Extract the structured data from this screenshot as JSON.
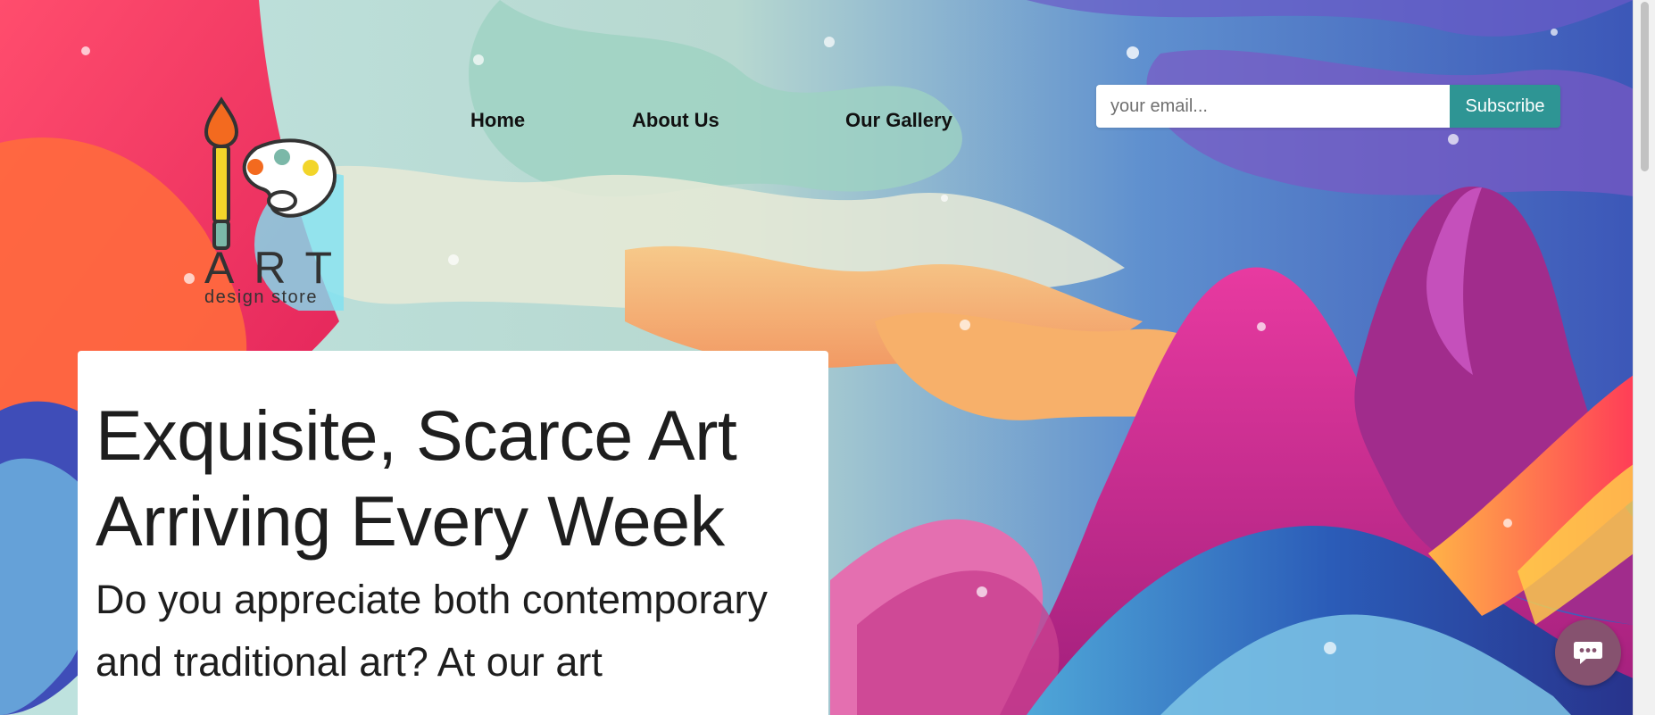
{
  "logo": {
    "brand": "ART",
    "tagline": "design store"
  },
  "nav": {
    "items": [
      {
        "label": "Home"
      },
      {
        "label": "About Us"
      },
      {
        "label": "Our Gallery"
      }
    ]
  },
  "subscribe": {
    "placeholder": "your email...",
    "button_label": "Subscribe"
  },
  "hero": {
    "heading": "Exquisite, Scarce Art Arriving Every Week",
    "body": "Do you appreciate both contemporary and traditional art? At our art"
  },
  "chat": {
    "icon": "chat-bubble-icon"
  },
  "colors": {
    "subscribe_button": "#2e9594",
    "chat_button": "#86526f",
    "text": "#1e1e1e"
  }
}
